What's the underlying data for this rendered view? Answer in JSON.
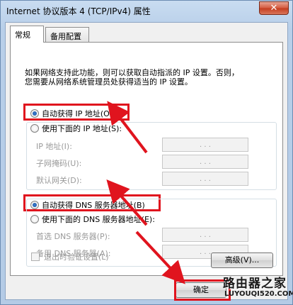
{
  "window": {
    "title": "Internet 协议版本 4 (TCP/IPv4) 属性",
    "close_label": "✕"
  },
  "tabs": [
    {
      "label": "常规",
      "active": true
    },
    {
      "label": "备用配置",
      "active": false
    }
  ],
  "description": {
    "line1": "如果网络支持此功能，则可以获取自动指派的 IP 设置。否则，",
    "line2": "您需要从网络系统管理员处获得适当的 IP 设置。"
  },
  "ip_section": {
    "auto_label": "自动获得 IP 地址(O)",
    "manual_label": "使用下面的 IP 地址(S):",
    "fields": [
      {
        "label": "IP 地址(I):",
        "value": ". . ."
      },
      {
        "label": "子网掩码(U):",
        "value": ". . ."
      },
      {
        "label": "默认网关(D):",
        "value": ". . ."
      }
    ]
  },
  "dns_section": {
    "auto_label": "自动获得 DNS 服务器地址(B)",
    "manual_label": "使用下面的 DNS 服务器地址(E):",
    "fields": [
      {
        "label": "首选 DNS 服务器(P):",
        "value": ". . ."
      },
      {
        "label": "备用 DNS 服务器(A):",
        "value": ". . ."
      }
    ]
  },
  "validate_checkbox": {
    "label": "退出时验证设置(L)",
    "checked": false
  },
  "buttons": {
    "advanced": "高级(V)...",
    "ok": "确定"
  },
  "watermark": {
    "top": "路由器之家",
    "bottom": "LUYOUQI520.COM"
  },
  "colors": {
    "highlight": "#e0141e",
    "arrow": "#e0141e"
  }
}
